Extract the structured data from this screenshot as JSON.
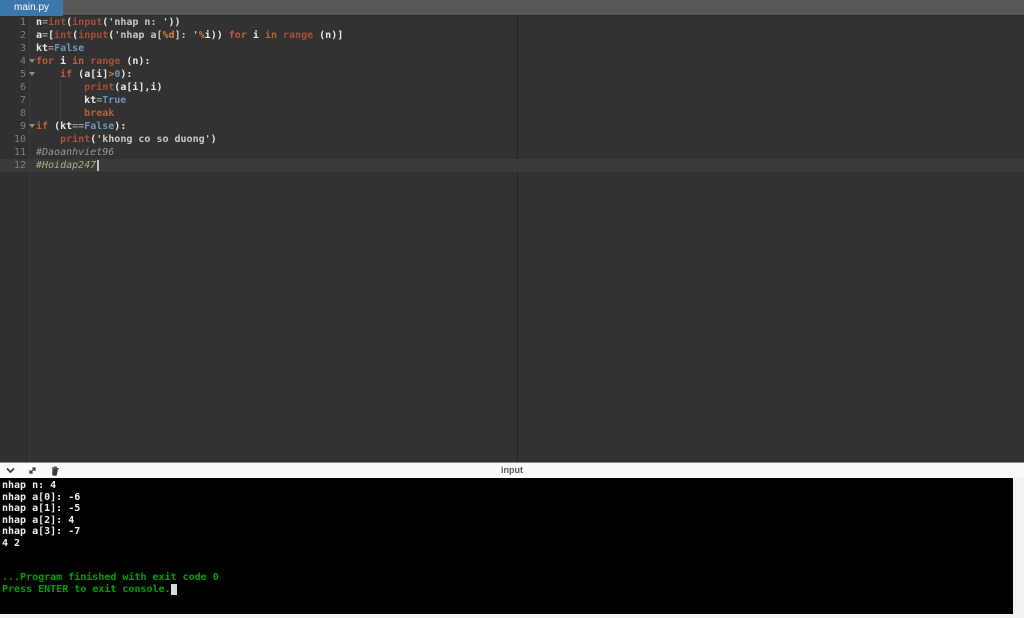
{
  "palette": {
    "tab_active_bg": "#3b77ad",
    "tabbar_bg": "#585858",
    "editor_bg": "#323232",
    "keyword": "#bb5d3d",
    "builtin": "#a5503a",
    "constant_blue": "#6d94bf",
    "string": "#cdc8bf",
    "comment": "#9b968d",
    "console_bg": "#000000",
    "console_text": "#efefef",
    "console_status_green": "#00a400"
  },
  "tab_bar": {
    "tabs": [
      {
        "label": "main.py",
        "active": true
      }
    ]
  },
  "editor": {
    "lines": [
      {
        "num": "1",
        "segs": [
          [
            "v",
            "n"
          ],
          [
            "o",
            "="
          ],
          [
            "f",
            "int"
          ],
          [
            "p",
            "("
          ],
          [
            "f",
            "input"
          ],
          [
            "p",
            "("
          ],
          [
            "s",
            "'nhap n: '"
          ],
          [
            "p",
            "))"
          ]
        ]
      },
      {
        "num": "2",
        "segs": [
          [
            "v",
            "a"
          ],
          [
            "o",
            "="
          ],
          [
            "p",
            "["
          ],
          [
            "f",
            "int"
          ],
          [
            "p",
            "("
          ],
          [
            "f",
            "input"
          ],
          [
            "p",
            "("
          ],
          [
            "s",
            "'nhap a["
          ],
          [
            "sf",
            "%d"
          ],
          [
            "s",
            "]: '"
          ],
          [
            "of",
            "%"
          ],
          [
            "v",
            "i"
          ],
          [
            "p",
            "))"
          ],
          [
            "p",
            " "
          ],
          [
            "k",
            "for"
          ],
          [
            "p",
            " "
          ],
          [
            "v",
            "i"
          ],
          [
            "p",
            " "
          ],
          [
            "k",
            "in"
          ],
          [
            "p",
            " "
          ],
          [
            "f",
            "range"
          ],
          [
            "p",
            " ("
          ],
          [
            "v",
            "n"
          ],
          [
            "p",
            ")]"
          ]
        ]
      },
      {
        "num": "3",
        "segs": [
          [
            "v",
            "kt"
          ],
          [
            "o",
            "="
          ],
          [
            "c",
            "False"
          ]
        ]
      },
      {
        "num": "4",
        "fold": true,
        "segs": [
          [
            "k",
            "for"
          ],
          [
            "p",
            " "
          ],
          [
            "v",
            "i"
          ],
          [
            "p",
            " "
          ],
          [
            "k",
            "in"
          ],
          [
            "p",
            " "
          ],
          [
            "f",
            "range"
          ],
          [
            "p",
            " ("
          ],
          [
            "v",
            "n"
          ],
          [
            "p",
            "):"
          ]
        ]
      },
      {
        "num": "5",
        "fold": true,
        "segs": [
          [
            "p",
            "    "
          ],
          [
            "k",
            "if"
          ],
          [
            "p",
            " ("
          ],
          [
            "v",
            "a"
          ],
          [
            "p",
            "["
          ],
          [
            "v",
            "i"
          ],
          [
            "p",
            "]"
          ],
          [
            "of",
            ">"
          ],
          [
            "c",
            "0"
          ],
          [
            "p",
            "):"
          ]
        ]
      },
      {
        "num": "6",
        "guides": [
          24
        ],
        "segs": [
          [
            "p",
            "        "
          ],
          [
            "f",
            "print"
          ],
          [
            "p",
            "("
          ],
          [
            "v",
            "a"
          ],
          [
            "p",
            "["
          ],
          [
            "v",
            "i"
          ],
          [
            "p",
            "],"
          ],
          [
            "v",
            "i"
          ],
          [
            "p",
            ")"
          ]
        ]
      },
      {
        "num": "7",
        "guides": [
          24
        ],
        "segs": [
          [
            "p",
            "        "
          ],
          [
            "v",
            "kt"
          ],
          [
            "o",
            "="
          ],
          [
            "c",
            "True"
          ]
        ]
      },
      {
        "num": "8",
        "guides": [
          24
        ],
        "segs": [
          [
            "p",
            "        "
          ],
          [
            "k",
            "break"
          ]
        ]
      },
      {
        "num": "9",
        "fold": true,
        "segs": [
          [
            "k",
            "if"
          ],
          [
            "p",
            " ("
          ],
          [
            "v",
            "kt"
          ],
          [
            "o",
            "=="
          ],
          [
            "c",
            "False"
          ],
          [
            "p",
            "):"
          ]
        ]
      },
      {
        "num": "10",
        "segs": [
          [
            "p",
            "    "
          ],
          [
            "f",
            "print"
          ],
          [
            "p",
            "("
          ],
          [
            "s",
            "'khong co so duong'"
          ],
          [
            "p",
            ")"
          ]
        ]
      },
      {
        "num": "11",
        "segs": [
          [
            "cm",
            "#Daoanhviet96"
          ]
        ]
      },
      {
        "num": "12",
        "active": true,
        "caret": true,
        "segs": [
          [
            "cm2",
            "#Hoidap247"
          ]
        ]
      }
    ]
  },
  "console_panel": {
    "toolbar": {
      "title": "input",
      "icons": [
        {
          "name": "chevron-down-icon"
        },
        {
          "name": "expand-icon"
        },
        {
          "name": "clear-console-icon"
        }
      ]
    },
    "lines": [
      {
        "type": "io",
        "text": "nhap n: 4"
      },
      {
        "type": "io",
        "text": "nhap a[0]: -6"
      },
      {
        "type": "io",
        "text": "nhap a[1]: -5"
      },
      {
        "type": "io",
        "text": "nhap a[2]: 4"
      },
      {
        "type": "io",
        "text": "nhap a[3]: -7"
      },
      {
        "type": "io",
        "text": "4 2"
      },
      {
        "type": "blank",
        "text": ""
      },
      {
        "type": "blank",
        "text": ""
      },
      {
        "type": "status",
        "text": "...Program finished with exit code 0"
      },
      {
        "type": "status",
        "text": "Press ENTER to exit console.",
        "cursor": true
      }
    ]
  }
}
